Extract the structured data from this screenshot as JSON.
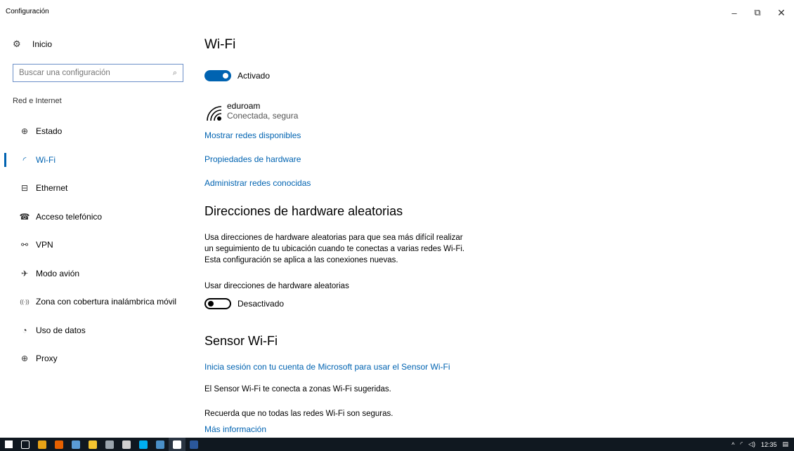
{
  "window": {
    "title": "Configuración",
    "minimize_glyph": "–",
    "maximize_glyph": "⧉",
    "close_glyph": "✕"
  },
  "sidebar": {
    "home_label": "Inicio",
    "home_icon": "gear-icon",
    "search_placeholder": "Buscar una configuración",
    "section_label": "Red e Internet",
    "items": [
      {
        "label": "Estado",
        "icon": "globe-icon",
        "glyph": "⊕",
        "active": false
      },
      {
        "label": "Wi-Fi",
        "icon": "wifi-icon",
        "glyph": "◜",
        "active": true
      },
      {
        "label": "Ethernet",
        "icon": "ethernet-icon",
        "glyph": "⊟",
        "active": false
      },
      {
        "label": "Acceso telefónico",
        "icon": "dialup-icon",
        "glyph": "☎",
        "active": false
      },
      {
        "label": "VPN",
        "icon": "vpn-icon",
        "glyph": "⚯",
        "active": false
      },
      {
        "label": "Modo avión",
        "icon": "airplane-icon",
        "glyph": "✈",
        "active": false
      },
      {
        "label": "Zona con cobertura inalámbrica móvil",
        "icon": "hotspot-icon",
        "glyph": "((·))",
        "active": false
      },
      {
        "label": "Uso de datos",
        "icon": "data-usage-icon",
        "glyph": "◔",
        "active": false
      },
      {
        "label": "Proxy",
        "icon": "proxy-globe-icon",
        "glyph": "⊕",
        "active": false
      }
    ]
  },
  "main": {
    "title": "Wi-Fi",
    "wifi_toggle": {
      "state": "on",
      "label": "Activado"
    },
    "network": {
      "name": "eduroam",
      "status": "Conectada, segura"
    },
    "links": {
      "show_networks": "Mostrar redes disponibles",
      "hardware_properties": "Propiedades de hardware",
      "manage_networks": "Administrar redes conocidas"
    },
    "random_hw": {
      "heading": "Direcciones de hardware aleatorias",
      "description": "Usa direcciones de hardware aleatorias para que sea más difícil realizar un seguimiento de tu ubicación cuando te conectas a varias redes Wi-Fi. Esta configuración se aplica a las conexiones nuevas.",
      "setting_label": "Usar direcciones de hardware aleatorias",
      "toggle": {
        "state": "off",
        "label": "Desactivado"
      }
    },
    "sensor": {
      "heading": "Sensor Wi-Fi",
      "signin_link": "Inicia sesión con tu cuenta de Microsoft para usar el Sensor Wi-Fi",
      "text1": "El Sensor Wi-Fi te conecta a zonas Wi-Fi sugeridas.",
      "text2": "Recuerda que no todas las redes Wi-Fi son seguras.",
      "more_info": "Más información"
    }
  },
  "taskbar": {
    "apps": [
      {
        "name": "start-icon",
        "color": "#ffffff"
      },
      {
        "name": "task-view-icon",
        "color": "#ffffff"
      },
      {
        "name": "chrome-icon",
        "color": "#e8a317"
      },
      {
        "name": "firefox-icon",
        "color": "#e66000"
      },
      {
        "name": "paint-icon",
        "color": "#5a9bd5"
      },
      {
        "name": "file-explorer-icon",
        "color": "#f4c430"
      },
      {
        "name": "terminal-icon",
        "color": "#9aa4ad"
      },
      {
        "name": "vpn-shield-icon",
        "color": "#d0d0d0"
      },
      {
        "name": "skype-icon",
        "color": "#00aff0"
      },
      {
        "name": "taskbar-app-icon",
        "color": "#4a90c8"
      },
      {
        "name": "settings-taskbar-icon",
        "color": "#ffffff"
      },
      {
        "name": "word-icon",
        "color": "#2b579a"
      }
    ],
    "active_app": "settings-taskbar-icon",
    "tray": {
      "chevron": "^",
      "time": "12:35"
    }
  }
}
